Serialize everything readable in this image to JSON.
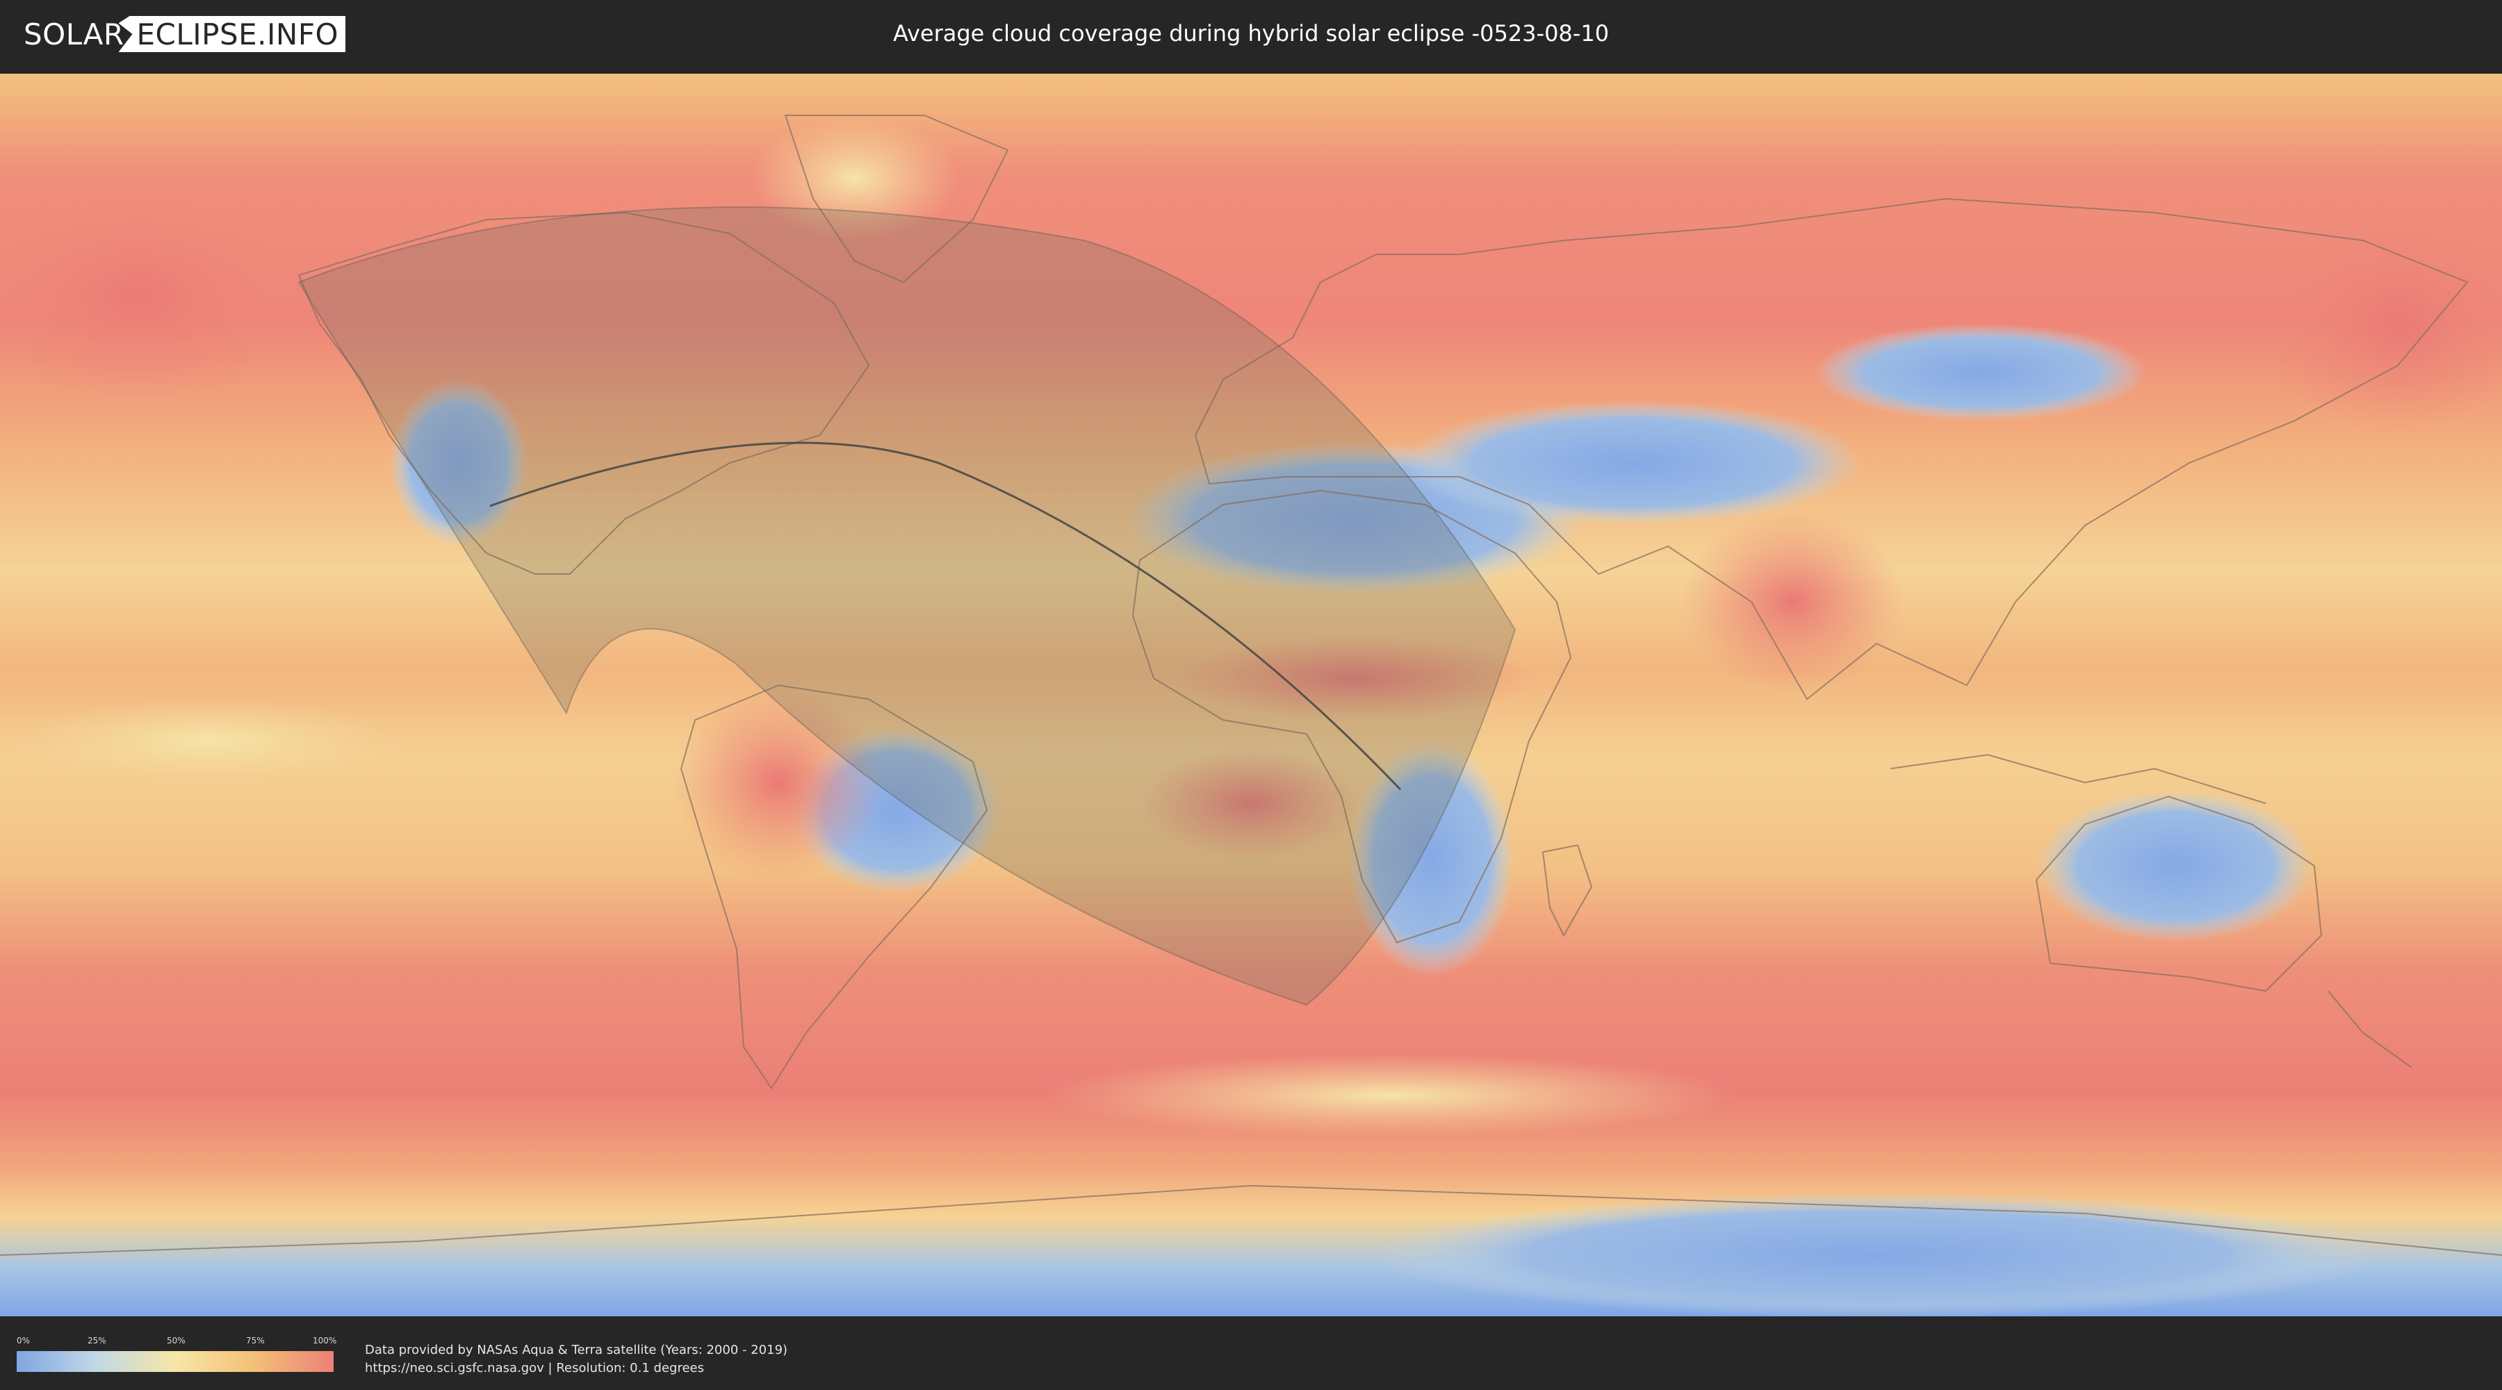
{
  "logo": {
    "left": "SOLAR",
    "right": "ECLIPSE.INFO"
  },
  "title": "Average cloud coverage during hybrid solar eclipse -0523-08-10",
  "legend": {
    "ticks": [
      "0%",
      "25%",
      "50%",
      "75%",
      "100%"
    ],
    "scale_colors": [
      "#7ea6e3",
      "#c2d8e6",
      "#f7e6a6",
      "#f4c077",
      "#ec8078"
    ]
  },
  "credits": {
    "line1": "Data provided by NASAs Aqua & Terra satellite (Years: 2000 - 2019)",
    "line2": "https://neo.sci.gsfc.nasa.gov | Resolution: 0.1 degrees"
  },
  "map": {
    "projection": "equirectangular",
    "layer": "cloud coverage",
    "colors": {
      "ocean_cloudy": "#ec8378",
      "mid_cloud": "#f5c67d",
      "low_cloud": "#f4e2a6",
      "clear": "#8fb0e4",
      "border": "#8a7060",
      "shadow_overlay": "#777766"
    }
  }
}
